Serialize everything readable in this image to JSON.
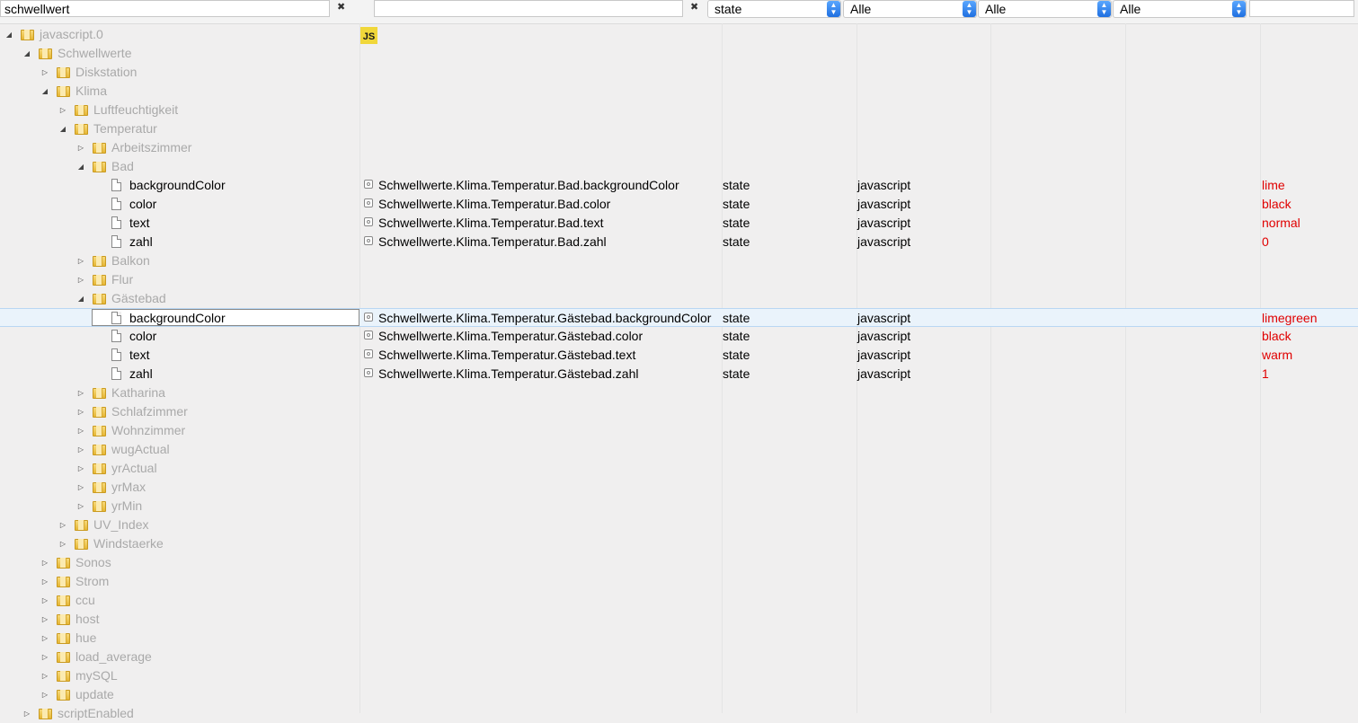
{
  "filters": {
    "name_value": "schwellwert",
    "id_value": "",
    "clear_symbol": "✖",
    "type_select": "state",
    "role_select": "Alle",
    "room_select": "Alle",
    "function_select": "Alle",
    "value_filter": ""
  },
  "adapter_badge": "JS",
  "tree": [
    {
      "label": "javascript.0",
      "kind": "folder",
      "expanded": true,
      "depth": 0
    },
    {
      "label": "Schwellwerte",
      "kind": "folder",
      "expanded": true,
      "depth": 1
    },
    {
      "label": "Diskstation",
      "kind": "folder",
      "expanded": false,
      "depth": 2
    },
    {
      "label": "Klima",
      "kind": "folder",
      "expanded": true,
      "depth": 2
    },
    {
      "label": "Luftfeuchtigkeit",
      "kind": "folder",
      "expanded": false,
      "depth": 3
    },
    {
      "label": "Temperatur",
      "kind": "folder",
      "expanded": true,
      "depth": 3
    },
    {
      "label": "Arbeitszimmer",
      "kind": "folder",
      "expanded": false,
      "depth": 4
    },
    {
      "label": "Bad",
      "kind": "folder",
      "expanded": true,
      "depth": 4
    },
    {
      "label": "backgroundColor",
      "kind": "state",
      "depth": 5,
      "id": "Schwellwerte.Klima.Temperatur.Bad.backgroundColor",
      "type": "state",
      "role": "javascript",
      "value": "lime"
    },
    {
      "label": "color",
      "kind": "state",
      "depth": 5,
      "id": "Schwellwerte.Klima.Temperatur.Bad.color",
      "type": "state",
      "role": "javascript",
      "value": "black"
    },
    {
      "label": "text",
      "kind": "state",
      "depth": 5,
      "id": "Schwellwerte.Klima.Temperatur.Bad.text",
      "type": "state",
      "role": "javascript",
      "value": "normal"
    },
    {
      "label": "zahl",
      "kind": "state",
      "depth": 5,
      "id": "Schwellwerte.Klima.Temperatur.Bad.zahl",
      "type": "state",
      "role": "javascript",
      "value": "0"
    },
    {
      "label": "Balkon",
      "kind": "folder",
      "expanded": false,
      "depth": 4
    },
    {
      "label": "Flur",
      "kind": "folder",
      "expanded": false,
      "depth": 4
    },
    {
      "label": "Gästebad",
      "kind": "folder",
      "expanded": true,
      "depth": 4
    },
    {
      "label": "backgroundColor",
      "kind": "state",
      "depth": 5,
      "selected": true,
      "id": "Schwellwerte.Klima.Temperatur.Gästebad.backgroundColor",
      "type": "state",
      "role": "javascript",
      "value": "limegreen"
    },
    {
      "label": "color",
      "kind": "state",
      "depth": 5,
      "id": "Schwellwerte.Klima.Temperatur.Gästebad.color",
      "type": "state",
      "role": "javascript",
      "value": "black"
    },
    {
      "label": "text",
      "kind": "state",
      "depth": 5,
      "id": "Schwellwerte.Klima.Temperatur.Gästebad.text",
      "type": "state",
      "role": "javascript",
      "value": "warm"
    },
    {
      "label": "zahl",
      "kind": "state",
      "depth": 5,
      "id": "Schwellwerte.Klima.Temperatur.Gästebad.zahl",
      "type": "state",
      "role": "javascript",
      "value": "1"
    },
    {
      "label": "Katharina",
      "kind": "folder",
      "expanded": false,
      "depth": 4
    },
    {
      "label": "Schlafzimmer",
      "kind": "folder",
      "expanded": false,
      "depth": 4
    },
    {
      "label": "Wohnzimmer",
      "kind": "folder",
      "expanded": false,
      "depth": 4
    },
    {
      "label": "wugActual",
      "kind": "folder",
      "expanded": false,
      "depth": 4
    },
    {
      "label": "yrActual",
      "kind": "folder",
      "expanded": false,
      "depth": 4
    },
    {
      "label": "yrMax",
      "kind": "folder",
      "expanded": false,
      "depth": 4
    },
    {
      "label": "yrMin",
      "kind": "folder",
      "expanded": false,
      "depth": 4
    },
    {
      "label": "UV_Index",
      "kind": "folder",
      "expanded": false,
      "depth": 3
    },
    {
      "label": "Windstaerke",
      "kind": "folder",
      "expanded": false,
      "depth": 3
    },
    {
      "label": "Sonos",
      "kind": "folder",
      "expanded": false,
      "depth": 2
    },
    {
      "label": "Strom",
      "kind": "folder",
      "expanded": false,
      "depth": 2
    },
    {
      "label": "ccu",
      "kind": "folder",
      "expanded": false,
      "depth": 2
    },
    {
      "label": "host",
      "kind": "folder",
      "expanded": false,
      "depth": 2
    },
    {
      "label": "hue",
      "kind": "folder",
      "expanded": false,
      "depth": 2
    },
    {
      "label": "load_average",
      "kind": "folder",
      "expanded": false,
      "depth": 2
    },
    {
      "label": "mySQL",
      "kind": "folder",
      "expanded": false,
      "depth": 2
    },
    {
      "label": "update",
      "kind": "folder",
      "expanded": false,
      "depth": 2
    },
    {
      "label": "scriptEnabled",
      "kind": "folder",
      "expanded": false,
      "depth": 1
    }
  ],
  "colors": {
    "value_text": "#e00000",
    "folder_label": "#a9a9a9",
    "selection": "#eaf3fb"
  }
}
